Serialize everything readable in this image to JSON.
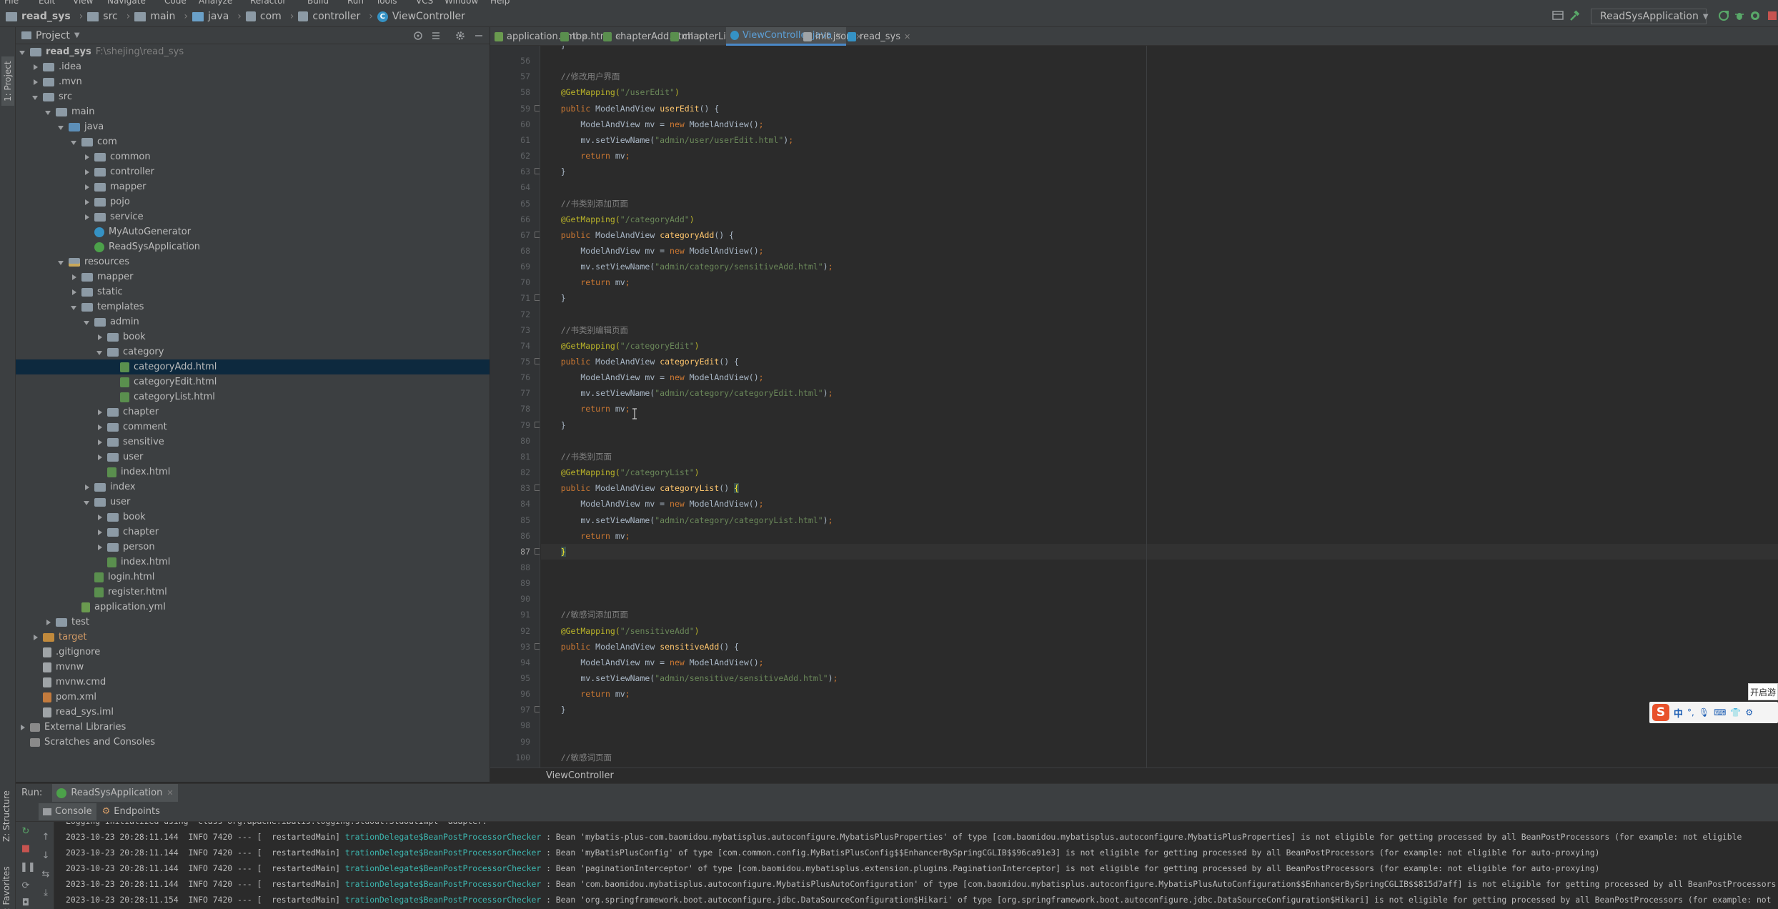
{
  "menu": [
    "File",
    "Edit",
    "View",
    "Navigate",
    "Code",
    "Analyze",
    "Refactor",
    "Build",
    "Run",
    "Tools",
    "VCS",
    "Window",
    "Help"
  ],
  "breadcrumb": {
    "items": [
      "read_sys",
      "src",
      "main",
      "java",
      "com",
      "controller",
      "ViewController"
    ]
  },
  "run_config": {
    "label": "ReadSysApplication"
  },
  "left_strip": {
    "project": "1: Project",
    "structure": "Z: Structure",
    "favorites": "2: Favorites"
  },
  "project_panel": {
    "title": "Project",
    "tree": [
      {
        "label": "read_sys",
        "hint": "F:\\shejing\\read_sys",
        "depth": 0,
        "arrow": "down",
        "icon": "folder",
        "bold": true
      },
      {
        "label": ".idea",
        "depth": 1,
        "arrow": "right",
        "icon": "folder"
      },
      {
        "label": ".mvn",
        "depth": 1,
        "arrow": "right",
        "icon": "folder"
      },
      {
        "label": "src",
        "depth": 1,
        "arrow": "down",
        "icon": "folder"
      },
      {
        "label": "main",
        "depth": 2,
        "arrow": "down",
        "icon": "folder"
      },
      {
        "label": "java",
        "depth": 3,
        "arrow": "down",
        "icon": "folder-blue"
      },
      {
        "label": "com",
        "depth": 4,
        "arrow": "down",
        "icon": "pkg"
      },
      {
        "label": "common",
        "depth": 5,
        "arrow": "right",
        "icon": "pkg"
      },
      {
        "label": "controller",
        "depth": 5,
        "arrow": "right",
        "icon": "pkg"
      },
      {
        "label": "mapper",
        "depth": 5,
        "arrow": "right",
        "icon": "pkg"
      },
      {
        "label": "pojo",
        "depth": 5,
        "arrow": "right",
        "icon": "pkg"
      },
      {
        "label": "service",
        "depth": 5,
        "arrow": "right",
        "icon": "pkg"
      },
      {
        "label": "MyAutoGenerator",
        "depth": 5,
        "arrow": "none",
        "icon": "java"
      },
      {
        "label": "ReadSysApplication",
        "depth": 5,
        "arrow": "none",
        "icon": "javaspring"
      },
      {
        "label": "resources",
        "depth": 3,
        "arrow": "down",
        "icon": "folder-res"
      },
      {
        "label": "mapper",
        "depth": 4,
        "arrow": "right",
        "icon": "folder"
      },
      {
        "label": "static",
        "depth": 4,
        "arrow": "right",
        "icon": "folder"
      },
      {
        "label": "templates",
        "depth": 4,
        "arrow": "down",
        "icon": "folder"
      },
      {
        "label": "admin",
        "depth": 5,
        "arrow": "down",
        "icon": "folder"
      },
      {
        "label": "book",
        "depth": 6,
        "arrow": "right",
        "icon": "folder"
      },
      {
        "label": "category",
        "depth": 6,
        "arrow": "down",
        "icon": "folder"
      },
      {
        "label": "categoryAdd.html",
        "depth": 7,
        "arrow": "none",
        "icon": "html",
        "selected": true
      },
      {
        "label": "categoryEdit.html",
        "depth": 7,
        "arrow": "none",
        "icon": "html"
      },
      {
        "label": "categoryList.html",
        "depth": 7,
        "arrow": "none",
        "icon": "html"
      },
      {
        "label": "chapter",
        "depth": 6,
        "arrow": "right",
        "icon": "folder"
      },
      {
        "label": "comment",
        "depth": 6,
        "arrow": "right",
        "icon": "folder"
      },
      {
        "label": "sensitive",
        "depth": 6,
        "arrow": "right",
        "icon": "folder"
      },
      {
        "label": "user",
        "depth": 6,
        "arrow": "right",
        "icon": "folder"
      },
      {
        "label": "index.html",
        "depth": 6,
        "arrow": "none",
        "icon": "html"
      },
      {
        "label": "index",
        "depth": 5,
        "arrow": "right",
        "icon": "folder"
      },
      {
        "label": "user",
        "depth": 5,
        "arrow": "down",
        "icon": "folder"
      },
      {
        "label": "book",
        "depth": 6,
        "arrow": "right",
        "icon": "folder"
      },
      {
        "label": "chapter",
        "depth": 6,
        "arrow": "right",
        "icon": "folder"
      },
      {
        "label": "person",
        "depth": 6,
        "arrow": "right",
        "icon": "folder"
      },
      {
        "label": "index.html",
        "depth": 6,
        "arrow": "none",
        "icon": "html"
      },
      {
        "label": "login.html",
        "depth": 5,
        "arrow": "none",
        "icon": "html"
      },
      {
        "label": "register.html",
        "depth": 5,
        "arrow": "none",
        "icon": "html"
      },
      {
        "label": "application.yml",
        "depth": 4,
        "arrow": "none",
        "icon": "yml"
      },
      {
        "label": "test",
        "depth": 2,
        "arrow": "right",
        "icon": "folder"
      },
      {
        "label": "target",
        "depth": 1,
        "arrow": "right",
        "icon": "folder-orange",
        "orange": true
      },
      {
        "label": ".gitignore",
        "depth": 1,
        "arrow": "none",
        "icon": "file"
      },
      {
        "label": "mvnw",
        "depth": 1,
        "arrow": "none",
        "icon": "file"
      },
      {
        "label": "mvnw.cmd",
        "depth": 1,
        "arrow": "none",
        "icon": "file"
      },
      {
        "label": "pom.xml",
        "depth": 1,
        "arrow": "none",
        "icon": "xml"
      },
      {
        "label": "read_sys.iml",
        "depth": 1,
        "arrow": "none",
        "icon": "file"
      },
      {
        "label": "External Libraries",
        "depth": 0,
        "arrow": "right",
        "icon": "lib"
      },
      {
        "label": "Scratches and Consoles",
        "depth": 0,
        "arrow": "none",
        "icon": "lib"
      }
    ]
  },
  "tabs": [
    {
      "label": "application.yml",
      "icon": "yml"
    },
    {
      "label": "top.html",
      "icon": "html"
    },
    {
      "label": "chapterAdd.html",
      "icon": "html"
    },
    {
      "label": "chapterList.html",
      "icon": "html"
    },
    {
      "label": "ViewController.java",
      "icon": "java",
      "active": true
    },
    {
      "label": "init.json",
      "icon": "file"
    },
    {
      "label": "read_sys",
      "icon": "m"
    }
  ],
  "editor": {
    "lines": [
      {
        "n": "",
        "tokens": [
          [
            "plain",
            "    }"
          ]
        ]
      },
      {
        "n": "56",
        "tokens": []
      },
      {
        "n": "57",
        "tokens": [
          [
            "cm",
            "    //修改用户界面"
          ]
        ]
      },
      {
        "n": "58",
        "tokens": [
          [
            "ann",
            "    @GetMapping("
          ],
          [
            "str",
            "\"/userEdit\""
          ],
          [
            "ann",
            ")"
          ]
        ]
      },
      {
        "n": "59",
        "tokens": [
          [
            "kw",
            "    public "
          ],
          [
            "plain",
            "ModelAndView "
          ],
          [
            "fn",
            "userEdit"
          ],
          [
            "plain",
            "() {"
          ]
        ]
      },
      {
        "n": "60",
        "tokens": [
          [
            "plain",
            "        ModelAndView mv = "
          ],
          [
            "kw",
            "new "
          ],
          [
            "plain",
            "ModelAndView()"
          ],
          [
            "kw",
            ";"
          ]
        ]
      },
      {
        "n": "61",
        "tokens": [
          [
            "plain",
            "        mv.setViewName("
          ],
          [
            "str",
            "\"admin/user/userEdit.html\""
          ],
          [
            "plain",
            ")"
          ],
          [
            "kw",
            ";"
          ]
        ]
      },
      {
        "n": "62",
        "tokens": [
          [
            "kw",
            "        return "
          ],
          [
            "plain",
            "mv"
          ],
          [
            "kw",
            ";"
          ]
        ]
      },
      {
        "n": "63",
        "tokens": [
          [
            "plain",
            "    }"
          ]
        ]
      },
      {
        "n": "64",
        "tokens": []
      },
      {
        "n": "65",
        "tokens": [
          [
            "cm",
            "    //书类别添加页面"
          ]
        ]
      },
      {
        "n": "66",
        "tokens": [
          [
            "ann",
            "    @GetMapping("
          ],
          [
            "str",
            "\"/categoryAdd\""
          ],
          [
            "ann",
            ")"
          ]
        ]
      },
      {
        "n": "67",
        "tokens": [
          [
            "kw",
            "    public "
          ],
          [
            "plain",
            "ModelAndView "
          ],
          [
            "fn",
            "categoryAdd"
          ],
          [
            "plain",
            "() {"
          ]
        ]
      },
      {
        "n": "68",
        "tokens": [
          [
            "plain",
            "        ModelAndView mv = "
          ],
          [
            "kw",
            "new "
          ],
          [
            "plain",
            "ModelAndView()"
          ],
          [
            "kw",
            ";"
          ]
        ]
      },
      {
        "n": "69",
        "tokens": [
          [
            "plain",
            "        mv.setViewName("
          ],
          [
            "str",
            "\"admin/category/sensitiveAdd.html\""
          ],
          [
            "plain",
            ")"
          ],
          [
            "kw",
            ";"
          ]
        ]
      },
      {
        "n": "70",
        "tokens": [
          [
            "kw",
            "        return "
          ],
          [
            "plain",
            "mv"
          ],
          [
            "kw",
            ";"
          ]
        ]
      },
      {
        "n": "71",
        "tokens": [
          [
            "plain",
            "    }"
          ]
        ]
      },
      {
        "n": "72",
        "tokens": []
      },
      {
        "n": "73",
        "tokens": [
          [
            "cm",
            "    //书类别编辑页面"
          ]
        ]
      },
      {
        "n": "74",
        "tokens": [
          [
            "ann",
            "    @GetMapping("
          ],
          [
            "str",
            "\"/categoryEdit\""
          ],
          [
            "ann",
            ")"
          ]
        ]
      },
      {
        "n": "75",
        "tokens": [
          [
            "kw",
            "    public "
          ],
          [
            "plain",
            "ModelAndView "
          ],
          [
            "fn",
            "categoryEdit"
          ],
          [
            "plain",
            "() {"
          ]
        ]
      },
      {
        "n": "76",
        "tokens": [
          [
            "plain",
            "        ModelAndView mv = "
          ],
          [
            "kw",
            "new "
          ],
          [
            "plain",
            "ModelAndView()"
          ],
          [
            "kw",
            ";"
          ]
        ]
      },
      {
        "n": "77",
        "tokens": [
          [
            "plain",
            "        mv.setViewName("
          ],
          [
            "str",
            "\"admin/category/categoryEdit.html\""
          ],
          [
            "plain",
            ")"
          ],
          [
            "kw",
            ";"
          ]
        ]
      },
      {
        "n": "78",
        "tokens": [
          [
            "kw",
            "        return "
          ],
          [
            "plain",
            "mv"
          ],
          [
            "kw",
            ";"
          ]
        ]
      },
      {
        "n": "79",
        "tokens": [
          [
            "plain",
            "    }"
          ]
        ]
      },
      {
        "n": "80",
        "tokens": []
      },
      {
        "n": "81",
        "tokens": [
          [
            "cm",
            "    //书类别页面"
          ]
        ]
      },
      {
        "n": "82",
        "tokens": [
          [
            "ann",
            "    @GetMapping("
          ],
          [
            "str",
            "\"/categoryList\""
          ],
          [
            "ann",
            ")"
          ]
        ]
      },
      {
        "n": "83",
        "tokens": [
          [
            "kw",
            "    public "
          ],
          [
            "plain",
            "ModelAndView "
          ],
          [
            "fn",
            "categoryList"
          ],
          [
            "plain",
            "() "
          ],
          [
            "match",
            "{"
          ]
        ]
      },
      {
        "n": "84",
        "tokens": [
          [
            "plain",
            "        ModelAndView mv = "
          ],
          [
            "kw",
            "new "
          ],
          [
            "plain",
            "ModelAndView()"
          ],
          [
            "kw",
            ";"
          ]
        ]
      },
      {
        "n": "85",
        "tokens": [
          [
            "plain",
            "        mv.setViewName("
          ],
          [
            "str",
            "\"admin/category/categoryList.html\""
          ],
          [
            "plain",
            ")"
          ],
          [
            "kw",
            ";"
          ]
        ]
      },
      {
        "n": "86",
        "tokens": [
          [
            "kw",
            "        return "
          ],
          [
            "plain",
            "mv"
          ],
          [
            "kw",
            ";"
          ]
        ]
      },
      {
        "n": "87",
        "tokens": [
          [
            "plain",
            "    "
          ],
          [
            "match",
            "}"
          ]
        ],
        "current": true
      },
      {
        "n": "88",
        "tokens": []
      },
      {
        "n": "89",
        "tokens": []
      },
      {
        "n": "90",
        "tokens": []
      },
      {
        "n": "91",
        "tokens": [
          [
            "cm",
            "    //敏感词添加页面"
          ]
        ]
      },
      {
        "n": "92",
        "tokens": [
          [
            "ann",
            "    @GetMapping("
          ],
          [
            "str",
            "\"/sensitiveAdd\""
          ],
          [
            "ann",
            ")"
          ]
        ]
      },
      {
        "n": "93",
        "tokens": [
          [
            "kw",
            "    public "
          ],
          [
            "plain",
            "ModelAndView "
          ],
          [
            "fn",
            "sensitiveAdd"
          ],
          [
            "plain",
            "() {"
          ]
        ]
      },
      {
        "n": "94",
        "tokens": [
          [
            "plain",
            "        ModelAndView mv = "
          ],
          [
            "kw",
            "new "
          ],
          [
            "plain",
            "ModelAndView()"
          ],
          [
            "kw",
            ";"
          ]
        ]
      },
      {
        "n": "95",
        "tokens": [
          [
            "plain",
            "        mv.setViewName("
          ],
          [
            "str",
            "\"admin/sensitive/sensitiveAdd.html\""
          ],
          [
            "plain",
            ")"
          ],
          [
            "kw",
            ";"
          ]
        ]
      },
      {
        "n": "96",
        "tokens": [
          [
            "kw",
            "        return "
          ],
          [
            "plain",
            "mv"
          ],
          [
            "kw",
            ";"
          ]
        ]
      },
      {
        "n": "97",
        "tokens": [
          [
            "plain",
            "    }"
          ]
        ]
      },
      {
        "n": "98",
        "tokens": []
      },
      {
        "n": "99",
        "tokens": []
      },
      {
        "n": "100",
        "tokens": [
          [
            "cm",
            "    //敏感词页面"
          ]
        ]
      }
    ],
    "current_line": "87",
    "breadcrumb": "ViewController"
  },
  "ime": {
    "tip": "开启游",
    "mode": "中"
  },
  "run_panel": {
    "label": "Run:",
    "config": "ReadSysApplication",
    "tabs": [
      "Console",
      "Endpoints"
    ],
    "logs": [
      {
        "text": "Logging initialized using 'class org.apache.ibatis.logging.stdout.StdOutImpl' adapter.",
        "cls": ""
      },
      {
        "text": "2023-10-23 20:28:11.144  INFO 7420 --- [  restartedMain] ",
        "cls": "trationDelegate$BeanPostProcessorChecker",
        "rest": " : Bean 'mybatis-plus-com.baomidou.mybatisplus.autoconfigure.MybatisPlusProperties' of type [com.baomidou.mybatisplus.autoconfigure.MybatisPlusProperties] is not eligible for getting processed by all BeanPostProcessors (for example: not eligible"
      },
      {
        "text": "2023-10-23 20:28:11.144  INFO 7420 --- [  restartedMain] ",
        "cls": "trationDelegate$BeanPostProcessorChecker",
        "rest": " : Bean 'myBatisPlusConfig' of type [com.common.config.MyBatisPlusConfig$$EnhancerBySpringCGLIB$$96ca91e3] is not eligible for getting processed by all BeanPostProcessors (for example: not eligible for auto-proxying)"
      },
      {
        "text": "2023-10-23 20:28:11.144  INFO 7420 --- [  restartedMain] ",
        "cls": "trationDelegate$BeanPostProcessorChecker",
        "rest": " : Bean 'paginationInterceptor' of type [com.baomidou.mybatisplus.extension.plugins.PaginationInterceptor] is not eligible for getting processed by all BeanPostProcessors (for example: not eligible for auto-proxying)"
      },
      {
        "text": "2023-10-23 20:28:11.144  INFO 7420 --- [  restartedMain] ",
        "cls": "trationDelegate$BeanPostProcessorChecker",
        "rest": " : Bean 'com.baomidou.mybatisplus.autoconfigure.MybatisPlusAutoConfiguration' of type [com.baomidou.mybatisplus.autoconfigure.MybatisPlusAutoConfiguration$$EnhancerBySpringCGLIB$$815d7aff] is not eligible for getting processed by all BeanPostProcessors"
      },
      {
        "text": "2023-10-23 20:28:11.154  INFO 7420 --- [  restartedMain] ",
        "cls": "trationDelegate$BeanPostProcessorChecker",
        "rest": " : Bean 'org.springframework.boot.autoconfigure.jdbc.DataSourceConfiguration$Hikari' of type [org.springframework.boot.autoconfigure.jdbc.DataSourceConfiguration$Hikari] is not eligible for getting processed by all BeanPostProcessors (for example: not"
      }
    ]
  },
  "colors": {
    "accent": "#4a88c7",
    "selection": "#0d293e",
    "log_class": "#3db7b0"
  }
}
